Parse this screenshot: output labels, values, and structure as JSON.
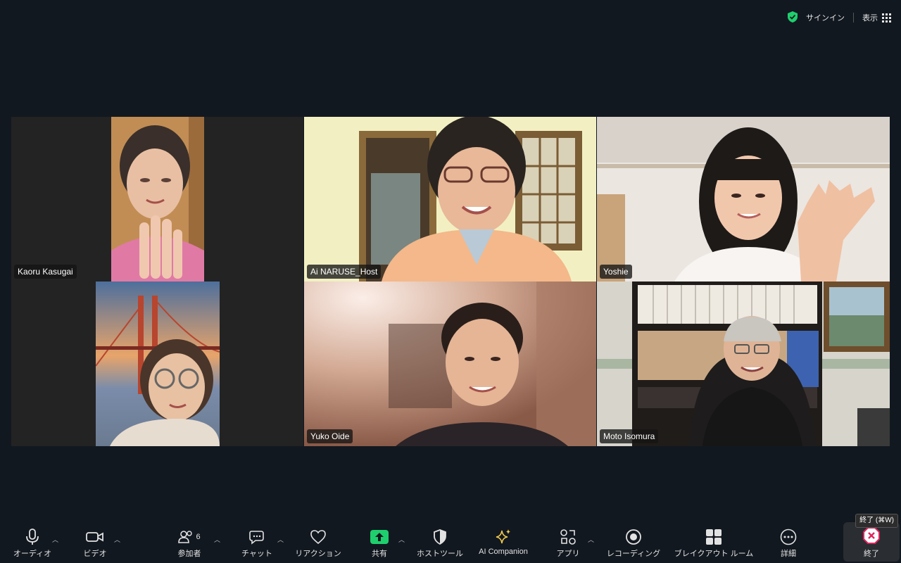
{
  "topbar": {
    "signin_label": "サインイン",
    "view_label": "表示"
  },
  "participants": [
    {
      "name": "Kaoru Kasugai"
    },
    {
      "name": "Ai NARUSE_Host"
    },
    {
      "name": "Yoshie"
    },
    {
      "name": "Yuko Oide"
    },
    {
      "name": "Moto Isomura"
    }
  ],
  "toolbar": {
    "audio": "オーディオ",
    "video": "ビデオ",
    "participants": "参加者",
    "participants_count": "6",
    "chat": "チャット",
    "reactions": "リアクション",
    "share": "共有",
    "host_tools": "ホストツール",
    "ai_companion": "AI Companion",
    "apps": "アプリ",
    "recording": "レコーディング",
    "breakout": "ブレイクアウト ルーム",
    "more": "詳細",
    "end": "終了",
    "end_tooltip": "終了 (⌘W)"
  },
  "colors": {
    "active_speaker": "#37c84a",
    "share_green": "#1fcf6d",
    "ai_yellow": "#f2c94c",
    "end_red": "#e0245e"
  }
}
